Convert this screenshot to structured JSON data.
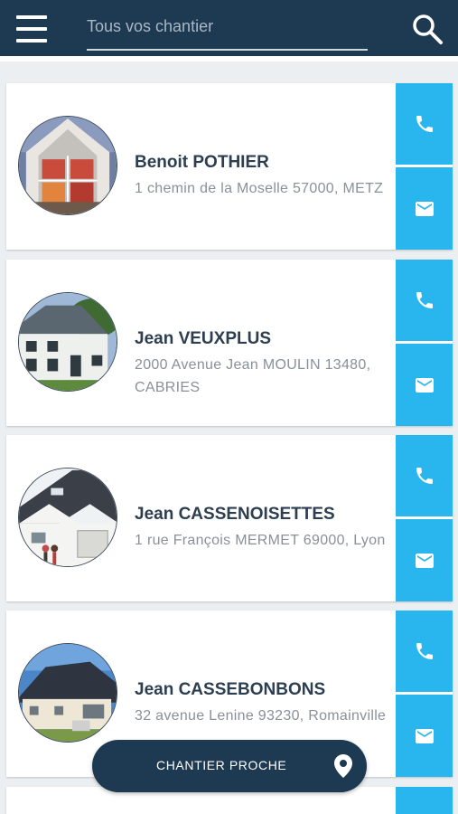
{
  "search": {
    "placeholder": "Tous vos chantier"
  },
  "icons": {
    "menu": "hamburger-menu-icon",
    "search": "search-icon",
    "phone": "phone-icon",
    "mail": "mail-icon",
    "location": "location-pin-icon"
  },
  "colors": {
    "header": "#1e3a52",
    "action": "#29b6ee",
    "name": "#2c3e50",
    "address": "#8a9099"
  },
  "contacts": [
    {
      "name": "Benoit POTHIER",
      "address": "1 chemin de la Moselle 57000, METZ"
    },
    {
      "name": "Jean VEUXPLUS",
      "address": "2000 Avenue Jean MOULIN 13480, CABRIES"
    },
    {
      "name": "Jean CASSENOISETTES",
      "address": "1 rue François MERMET 69000, Lyon"
    },
    {
      "name": "Jean CASSEBONBONS",
      "address": "32 avenue Lenine 93230, Romainville"
    }
  ],
  "fab": {
    "label": "CHANTIER PROCHE"
  }
}
